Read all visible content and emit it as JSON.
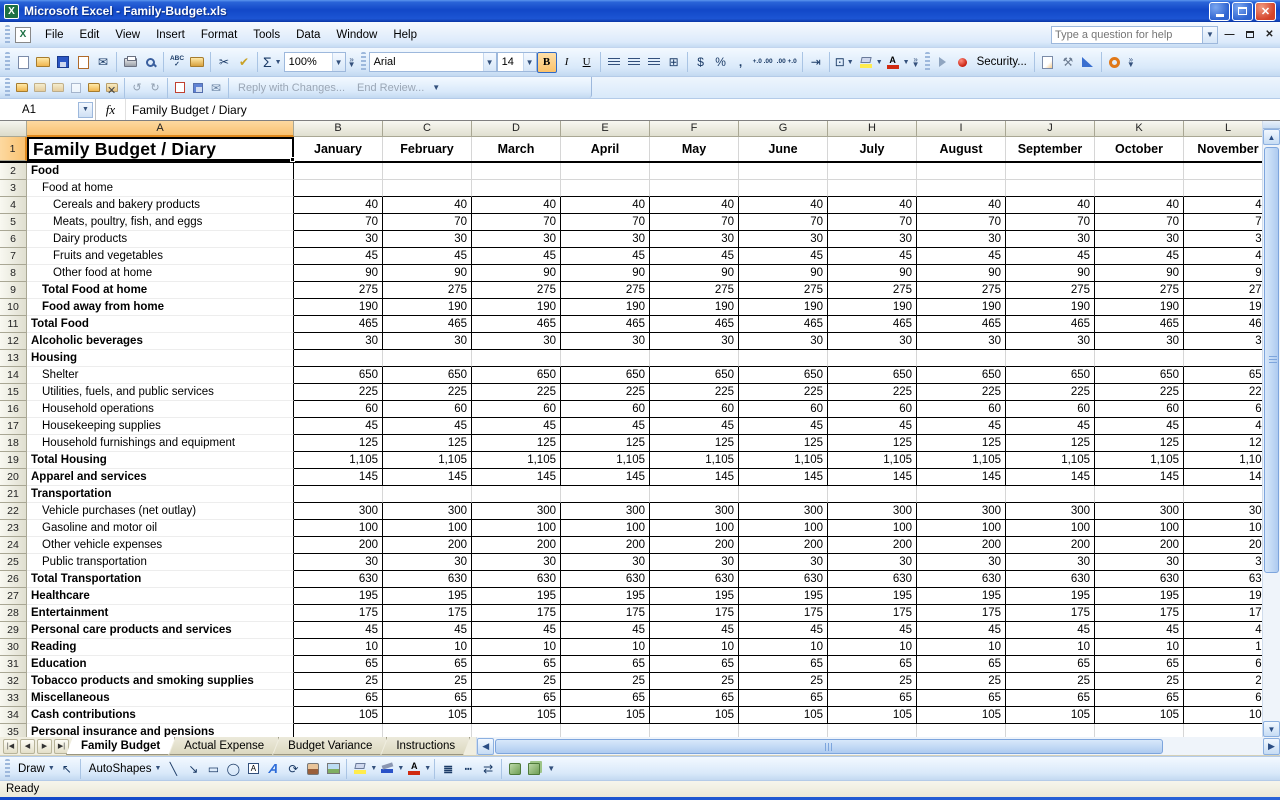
{
  "title_bar": {
    "title": "Microsoft Excel - Family-Budget.xls"
  },
  "menu_bar": {
    "items": [
      "File",
      "Edit",
      "View",
      "Insert",
      "Format",
      "Tools",
      "Data",
      "Window",
      "Help"
    ],
    "question_placeholder": "Type a question for help"
  },
  "standard_toolbar": {
    "sum": "Σ",
    "zoom": "100%"
  },
  "formatting_toolbar": {
    "font": "Arial",
    "size": "14",
    "bold": "B",
    "italic": "I",
    "underline": "U",
    "currency": "$",
    "percent": "%",
    "comma": ",",
    "inc_decimal": "+.0 .00",
    "dec_decimal": ".00 +.0"
  },
  "macro_toolbar": {
    "security": "Security..."
  },
  "reviewing_toolbar": {
    "reply": "Reply with Changes...",
    "end_review": "End Review..."
  },
  "formula_bar": {
    "name_box": "A1",
    "fx": "fx",
    "value": "Family Budget / Diary"
  },
  "sheet": {
    "column_letters": [
      "A",
      "B",
      "C",
      "D",
      "E",
      "F",
      "G",
      "H",
      "I",
      "J",
      "K",
      "L"
    ],
    "title_cell": "Family Budget / Diary",
    "months": [
      "January",
      "February",
      "March",
      "April",
      "May",
      "June",
      "July",
      "August",
      "September",
      "October",
      "November"
    ],
    "rows": [
      {
        "n": 2,
        "label": "Food",
        "indent": 0,
        "bold": true,
        "value": null
      },
      {
        "n": 3,
        "label": "Food at home",
        "indent": 1,
        "bold": false,
        "value": null
      },
      {
        "n": 4,
        "label": "Cereals and bakery products",
        "indent": 2,
        "bold": false,
        "value": "40"
      },
      {
        "n": 5,
        "label": "Meats, poultry, fish, and eggs",
        "indent": 2,
        "bold": false,
        "value": "70"
      },
      {
        "n": 6,
        "label": "Dairy products",
        "indent": 2,
        "bold": false,
        "value": "30"
      },
      {
        "n": 7,
        "label": "Fruits and vegetables",
        "indent": 2,
        "bold": false,
        "value": "45"
      },
      {
        "n": 8,
        "label": "Other food at home",
        "indent": 2,
        "bold": false,
        "value": "90"
      },
      {
        "n": 9,
        "label": "Total Food at home",
        "indent": 1,
        "bold": true,
        "value": "275"
      },
      {
        "n": 10,
        "label": "Food away from home",
        "indent": 1,
        "bold": true,
        "value": "190"
      },
      {
        "n": 11,
        "label": "Total Food",
        "indent": 0,
        "bold": true,
        "value": "465"
      },
      {
        "n": 12,
        "label": "Alcoholic beverages",
        "indent": 0,
        "bold": true,
        "value": "30"
      },
      {
        "n": 13,
        "label": "Housing",
        "indent": 0,
        "bold": true,
        "value": null
      },
      {
        "n": 14,
        "label": "Shelter",
        "indent": 1,
        "bold": false,
        "value": "650"
      },
      {
        "n": 15,
        "label": "Utilities, fuels, and public services",
        "indent": 1,
        "bold": false,
        "value": "225"
      },
      {
        "n": 16,
        "label": "Household operations",
        "indent": 1,
        "bold": false,
        "value": "60"
      },
      {
        "n": 17,
        "label": "Housekeeping supplies",
        "indent": 1,
        "bold": false,
        "value": "45"
      },
      {
        "n": 18,
        "label": "Household furnishings and equipment",
        "indent": 1,
        "bold": false,
        "value": "125"
      },
      {
        "n": 19,
        "label": "Total Housing",
        "indent": 0,
        "bold": true,
        "value": "1,105"
      },
      {
        "n": 20,
        "label": "Apparel and services",
        "indent": 0,
        "bold": true,
        "value": "145"
      },
      {
        "n": 21,
        "label": "Transportation",
        "indent": 0,
        "bold": true,
        "value": null
      },
      {
        "n": 22,
        "label": "Vehicle purchases (net outlay)",
        "indent": 1,
        "bold": false,
        "value": "300"
      },
      {
        "n": 23,
        "label": "Gasoline and motor oil",
        "indent": 1,
        "bold": false,
        "value": "100"
      },
      {
        "n": 24,
        "label": "Other vehicle expenses",
        "indent": 1,
        "bold": false,
        "value": "200"
      },
      {
        "n": 25,
        "label": "Public transportation",
        "indent": 1,
        "bold": false,
        "value": "30"
      },
      {
        "n": 26,
        "label": "Total Transportation",
        "indent": 0,
        "bold": true,
        "value": "630"
      },
      {
        "n": 27,
        "label": "Healthcare",
        "indent": 0,
        "bold": true,
        "value": "195"
      },
      {
        "n": 28,
        "label": "Entertainment",
        "indent": 0,
        "bold": true,
        "value": "175"
      },
      {
        "n": 29,
        "label": "Personal care products and services",
        "indent": 0,
        "bold": true,
        "value": "45"
      },
      {
        "n": 30,
        "label": "Reading",
        "indent": 0,
        "bold": true,
        "value": "10"
      },
      {
        "n": 31,
        "label": "Education",
        "indent": 0,
        "bold": true,
        "value": "65"
      },
      {
        "n": 32,
        "label": "Tobacco products and smoking supplies",
        "indent": 0,
        "bold": true,
        "value": "25"
      },
      {
        "n": 33,
        "label": "Miscellaneous",
        "indent": 0,
        "bold": true,
        "value": "65"
      },
      {
        "n": 34,
        "label": "Cash contributions",
        "indent": 0,
        "bold": true,
        "value": "105"
      },
      {
        "n": 35,
        "label": "Personal insurance and pensions",
        "indent": 0,
        "bold": true,
        "value": null
      }
    ]
  },
  "sheet_tabs": [
    "Family Budget",
    "Actual Expense",
    "Budget Variance",
    "Instructions"
  ],
  "active_tab": "Family Budget",
  "draw_toolbar": {
    "draw": "Draw",
    "autoshapes": "AutoShapes"
  },
  "status_bar": {
    "text": "Ready"
  },
  "colors": {
    "titlebar": "#1248c8",
    "selected_header": "#fbc870",
    "toolbar": "#d9e9fa",
    "gridline": "#d6d6d6"
  }
}
